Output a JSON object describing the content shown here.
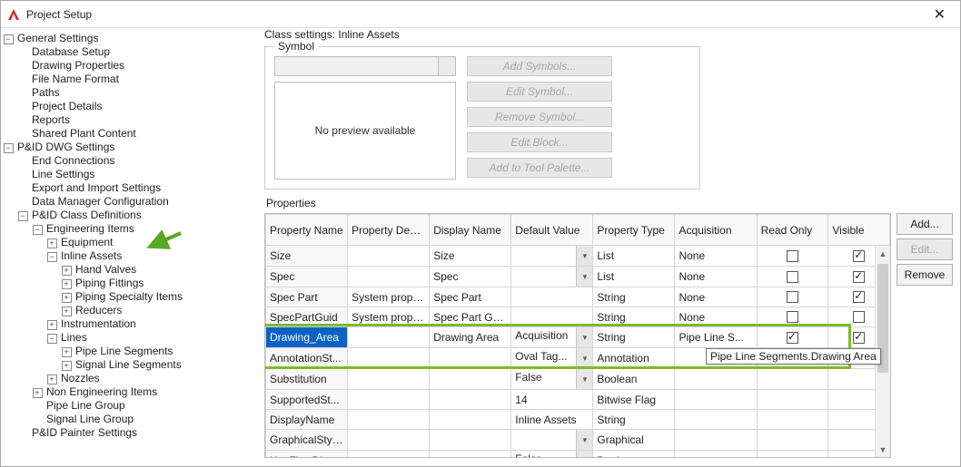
{
  "window": {
    "title": "Project Setup"
  },
  "tree": {
    "items": [
      {
        "depth": 0,
        "toggle": "-",
        "label": "General Settings"
      },
      {
        "depth": 1,
        "toggle": "",
        "label": "Database Setup"
      },
      {
        "depth": 1,
        "toggle": "",
        "label": "Drawing Properties"
      },
      {
        "depth": 1,
        "toggle": "",
        "label": "File Name Format"
      },
      {
        "depth": 1,
        "toggle": "",
        "label": "Paths"
      },
      {
        "depth": 1,
        "toggle": "",
        "label": "Project Details"
      },
      {
        "depth": 1,
        "toggle": "",
        "label": "Reports"
      },
      {
        "depth": 1,
        "toggle": "",
        "label": "Shared Plant Content"
      },
      {
        "depth": 0,
        "toggle": "-",
        "label": "P&ID DWG Settings"
      },
      {
        "depth": 1,
        "toggle": "",
        "label": "End Connections"
      },
      {
        "depth": 1,
        "toggle": "",
        "label": "Line Settings"
      },
      {
        "depth": 1,
        "toggle": "",
        "label": "Export and Import Settings"
      },
      {
        "depth": 1,
        "toggle": "",
        "label": "Data Manager Configuration"
      },
      {
        "depth": 1,
        "toggle": "-",
        "label": "P&ID Class Definitions"
      },
      {
        "depth": 2,
        "toggle": "-",
        "label": "Engineering Items"
      },
      {
        "depth": 3,
        "toggle": "+",
        "label": "Equipment"
      },
      {
        "depth": 3,
        "toggle": "-",
        "label": "Inline Assets"
      },
      {
        "depth": 4,
        "toggle": "+",
        "label": "Hand Valves"
      },
      {
        "depth": 4,
        "toggle": "+",
        "label": "Piping Fittings"
      },
      {
        "depth": 4,
        "toggle": "+",
        "label": "Piping Specialty Items"
      },
      {
        "depth": 4,
        "toggle": "+",
        "label": "Reducers"
      },
      {
        "depth": 3,
        "toggle": "+",
        "label": "Instrumentation"
      },
      {
        "depth": 3,
        "toggle": "-",
        "label": "Lines"
      },
      {
        "depth": 4,
        "toggle": "+",
        "label": "Pipe Line Segments"
      },
      {
        "depth": 4,
        "toggle": "+",
        "label": "Signal Line Segments"
      },
      {
        "depth": 3,
        "toggle": "+",
        "label": "Nozzles"
      },
      {
        "depth": 2,
        "toggle": "+",
        "label": "Non Engineering Items"
      },
      {
        "depth": 2,
        "toggle": "",
        "label": "Pipe Line Group"
      },
      {
        "depth": 2,
        "toggle": "",
        "label": "Signal Line Group"
      },
      {
        "depth": 1,
        "toggle": "",
        "label": "P&ID Painter Settings"
      }
    ]
  },
  "content": {
    "class_settings_label": "Class settings: Inline Assets",
    "symbol": {
      "legend": "Symbol",
      "no_preview": "No preview available",
      "buttons": {
        "add": "Add Symbols...",
        "edit": "Edit Symbol...",
        "remove": "Remove Symbol...",
        "edit_block": "Edit Block...",
        "tool_palette": "Add to Tool Palette..."
      }
    },
    "properties_label": "Properties",
    "grid": {
      "headers": {
        "name": "Property Name",
        "desc": "Property Description",
        "display": "Display Name",
        "default": "Default Value",
        "type": "Property Type",
        "acq": "Acquisition",
        "ro": "Read Only",
        "vis": "Visible"
      },
      "rows": [
        {
          "name": "Size",
          "desc": "",
          "display": "Size",
          "default": "",
          "dd": true,
          "type": "List",
          "acq": "None",
          "ro": false,
          "vis": true
        },
        {
          "name": "Spec",
          "desc": "",
          "display": "Spec",
          "default": "",
          "dd": true,
          "type": "List",
          "acq": "None",
          "ro": false,
          "vis": true
        },
        {
          "name": "Spec Part",
          "desc": "System prope...",
          "display": "Spec Part",
          "default": "",
          "type": "String",
          "acq": "None",
          "ro": false,
          "vis": true
        },
        {
          "name": "SpecPartGuid",
          "desc": "System prope...",
          "display": "Spec Part Guid",
          "default": "",
          "type": "String",
          "acq": "None",
          "ro": false,
          "vis": false
        },
        {
          "name": "Drawing_Area",
          "desc": "",
          "display": "Drawing Area",
          "default": "Acquisition",
          "dd": true,
          "type": "String",
          "acq": "Pipe Line S...",
          "ro": true,
          "vis": true,
          "selected": true
        },
        {
          "name": "AnnotationSt...",
          "desc": "",
          "display": "",
          "default": "Oval Tag...",
          "dd": true,
          "type": "Annotation",
          "acq": ""
        },
        {
          "name": "Substitution",
          "desc": "",
          "display": "",
          "default": "False",
          "dd": true,
          "type": "Boolean",
          "acq": ""
        },
        {
          "name": "SupportedSt...",
          "desc": "",
          "display": "",
          "default": "14",
          "type": "Bitwise Flag",
          "acq": ""
        },
        {
          "name": "DisplayName",
          "desc": "",
          "display": "",
          "default": "Inline Assets",
          "type": "String",
          "acq": ""
        },
        {
          "name": "GraphicalStyl...",
          "desc": "",
          "display": "",
          "default": "",
          "dd": true,
          "type": "Graphical",
          "acq": ""
        },
        {
          "name": "HasFlowDire...",
          "desc": "",
          "display": "",
          "default": "False",
          "dd": true,
          "type": "Boolean",
          "acq": ""
        }
      ]
    },
    "side": {
      "add": "Add...",
      "edit": "Edit...",
      "remove": "Remove"
    },
    "tooltip": "Pipe Line Segments.Drawing Area"
  }
}
